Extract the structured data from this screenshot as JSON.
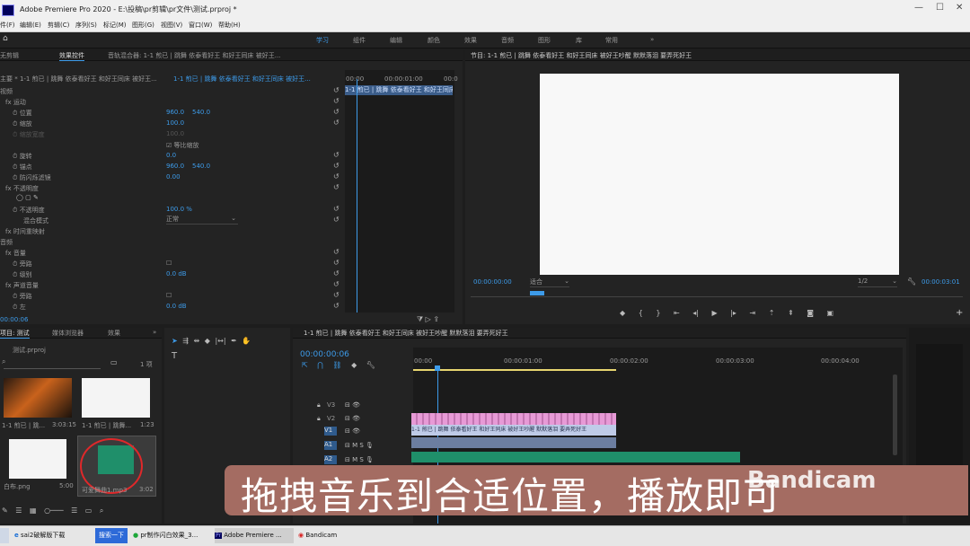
{
  "window": {
    "title": "Adobe Premiere Pro 2020 - E:\\投稿\\pr剪辑\\pr文件\\测试.prproj *"
  },
  "menu": [
    "件(F)",
    "编辑(E)",
    "剪辑(C)",
    "序列(S)",
    "标记(M)",
    "图形(G)",
    "视图(V)",
    "窗口(W)",
    "帮助(H)"
  ],
  "workspaces": [
    "学习",
    "组件",
    "编辑",
    "颜色",
    "效果",
    "音频",
    "图形",
    "库",
    "常用",
    "»"
  ],
  "effect_controls": {
    "tabs": [
      "无剪辑",
      "效果控件",
      "音轨混合器: 1-1 煎已 | 跳舞 依泰看好王 和好王同床 被好王..."
    ],
    "clip_label": "主要 * 1-1 煎已 | 跳舞 依泰看好王 和好王同床 被好王...",
    "clip_label2": "1-1 煎已 | 跳舞 依泰看好王 和好王同床 被好王...",
    "section_video": "视频",
    "motion": "运动",
    "position_label": "位置",
    "position_x": "960.0",
    "position_y": "540.0",
    "scale_label": "缩放",
    "scale": "100.0",
    "scale_w_label": "缩放宽度",
    "scale_w": "100.0",
    "uniform": "等比缩放",
    "rotation_label": "旋转",
    "rotation": "0.0",
    "anchor_label": "锚点",
    "anchor_x": "960.0",
    "anchor_y": "540.0",
    "flicker_label": "防闪烁滤镜",
    "flicker": "0.00",
    "opacity_group": "不透明度",
    "opacity_label": "不透明度",
    "opacity": "100.0 %",
    "blend_label": "混合模式",
    "blend": "正常",
    "time_remap": "时间重映射",
    "section_audio": "音频",
    "volume": "音量",
    "bypass_label": "旁路",
    "level_label": "级别",
    "level": "0.0 dB",
    "channel_volume": "声道音量",
    "bypass2_label": "旁路",
    "left_label": "左",
    "left": "0.0 dB",
    "timecode": "00:00:06",
    "ruler_start": "00:00",
    "ruler_mid": "00:00:01:00",
    "ruler_end": "00:0"
  },
  "program": {
    "title": "节目: 1-1 煎已 | 跳舞 依泰看好王 和好王同床 被好王吵醒 默默落泪 要弄死好王",
    "timecode_left": "00:00:00:00",
    "fit": "适合",
    "quality": "1/2",
    "timecode_right": "00:00:03:01"
  },
  "project": {
    "tabs": [
      "项目: 测试",
      "媒体浏览器",
      "效果"
    ],
    "file": "测试.prproj",
    "count": "1 项",
    "items": [
      {
        "name": "1-1 煎已 | 跳...",
        "duration": "3:03:15"
      },
      {
        "name": "1-1 煎已 | 跳舞...",
        "duration": "1:23"
      },
      {
        "name": "白布.png",
        "duration": "5:00"
      },
      {
        "name": "可爱舞曲1.mp3",
        "duration": "3:02"
      }
    ]
  },
  "timeline": {
    "title": "1-1 煎已 | 跳舞 依泰看好王 和好王同床 被好王吵醒 默默落泪 要弄死好王",
    "timecode": "00:00:00:06",
    "ruler": [
      "00:00",
      "00:00:01:00",
      "00:00:02:00",
      "00:00:03:00",
      "00:00:04:00"
    ],
    "tracks": [
      "V3",
      "V2",
      "V1",
      "A1",
      "A2"
    ],
    "clip_label": "1-1 煎已 | 跳舞 依泰看好王 和好王同床 被好王吵醒 默默落泪 要弄死好王"
  },
  "subtitle": "拖拽音乐到合适位置，播放即可",
  "watermark": "Bandicam",
  "taskbar": {
    "items": [
      "sai2破解版下载",
      "搜索一下",
      "pr制作闪白效果_3...",
      "Adobe Premiere ...",
      "Bandicam"
    ]
  },
  "colors": {
    "accent": "#3d9be9",
    "audio_clip": "#1f8f6a",
    "video_clip": "#e79ad6"
  }
}
